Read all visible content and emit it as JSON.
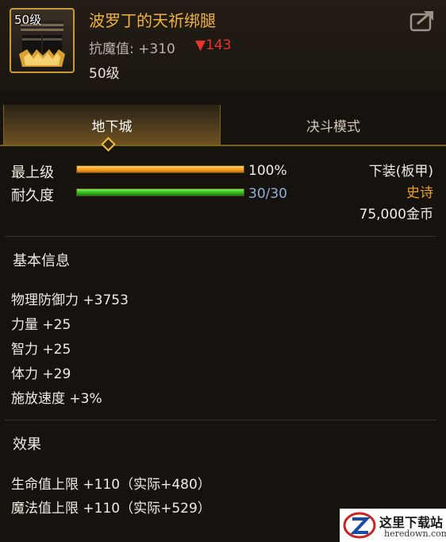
{
  "item": {
    "level_badge": "50级",
    "name": "波罗丁的天祈绑腿",
    "resist_label": "抗魔值: +310",
    "resist_delta": "▼143",
    "required_level": "50级"
  },
  "tabs": [
    {
      "label": "地下城",
      "active": true
    },
    {
      "label": "决斗模式",
      "active": false
    }
  ],
  "bars": {
    "max_level": {
      "label": "最上级",
      "value": "100%",
      "fraction": 1.0
    },
    "durability": {
      "label": "耐久度",
      "value": "30/30",
      "fraction": 1.0
    }
  },
  "meta": {
    "slot": "下装(板甲)",
    "rarity": "史诗",
    "price": "75,000金币"
  },
  "basic_info": {
    "title": "基本信息",
    "stats": [
      "物理防御力 +3753",
      "力量 +25",
      "智力 +25",
      "体力 +29",
      "施放速度 +3%"
    ]
  },
  "effects": {
    "title": "效果",
    "lines": [
      "生命值上限 +110（实际+480）",
      "魔法值上限 +110（实际+529）"
    ]
  },
  "watermark": {
    "name": "这里下载站",
    "url": "heredown.com"
  },
  "colors": {
    "item_name": "#f0b23a",
    "rarity_epic": "#f0a020",
    "resist_down": "#e8342c",
    "durability_value": "#8fb0d8"
  },
  "icons": {
    "share": "share-icon",
    "item": "leg-armor-icon",
    "tab_indicator": "diamond-icon",
    "watermark_logo": "watermark-logo-icon"
  }
}
